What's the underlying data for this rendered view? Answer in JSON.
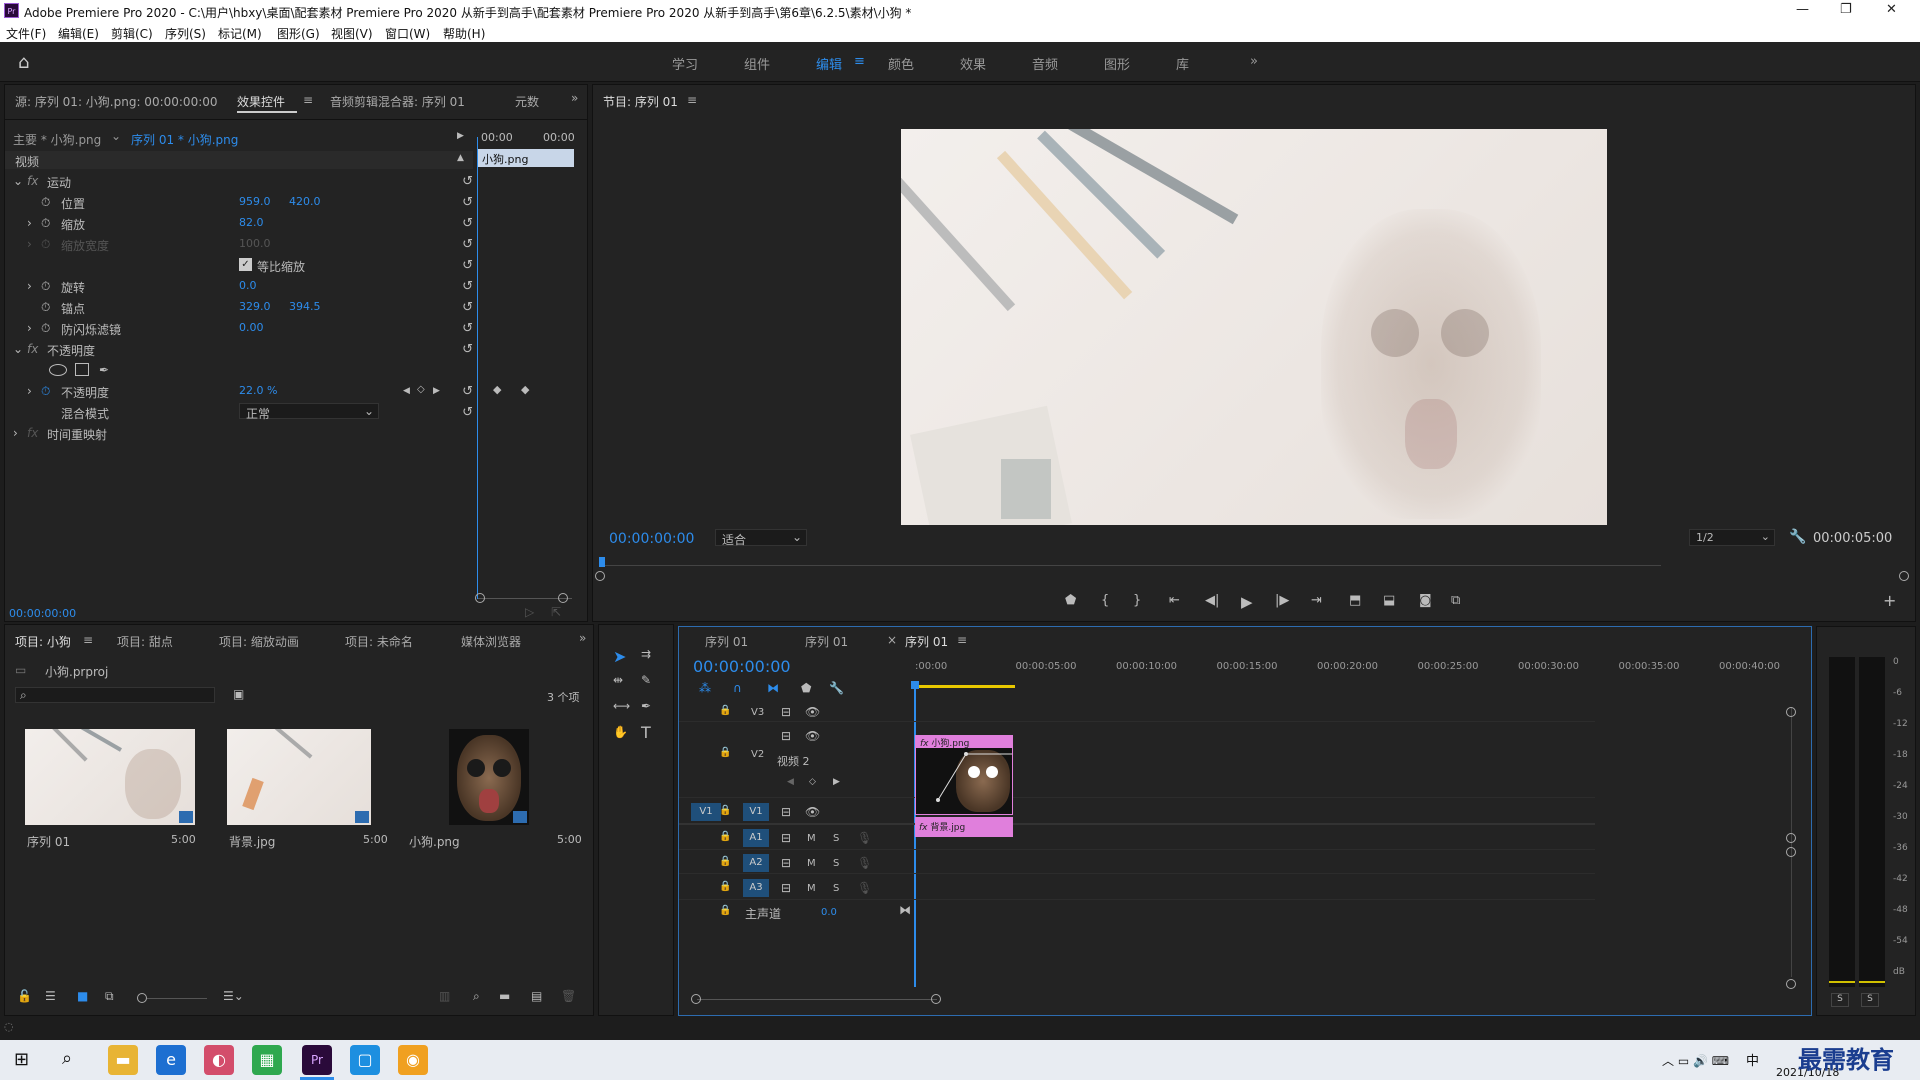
{
  "window": {
    "title": "Adobe Premiere Pro 2020 - C:\\用户\\hbxy\\桌面\\配套素材 Premiere Pro 2020 从新手到高手\\配套素材 Premiere Pro 2020 从新手到高手\\第6章\\6.2.5\\素材\\小狗 *",
    "app_badge": "Pr"
  },
  "menu": [
    "文件(F)",
    "编辑(E)",
    "剪辑(C)",
    "序列(S)",
    "标记(M)",
    "图形(G)",
    "视图(V)",
    "窗口(W)",
    "帮助(H)"
  ],
  "workspaces": [
    "学习",
    "组件",
    "编辑",
    "颜色",
    "效果",
    "音频",
    "图形",
    "库"
  ],
  "active_workspace": "编辑",
  "source_panel": {
    "tabs": [
      "源: 序列 01: 小狗.png: 00:00:00:00",
      "效果控件",
      "音频剪辑混合器: 序列 01",
      "元数"
    ],
    "master": "主要 * 小狗.png",
    "sequence": "序列 01 * 小狗.png",
    "time_start": "00:00",
    "time_end": "00:00",
    "clip_label": "小狗.png",
    "section_video": "视频",
    "motion": "运动",
    "position_label": "位置",
    "position_x": "959.0",
    "position_y": "420.0",
    "scale_label": "缩放",
    "scale": "82.0",
    "scale_width_label": "缩放宽度",
    "scale_width": "100.0",
    "uniform_label": "等比缩放",
    "rotation_label": "旋转",
    "rotation": "0.0",
    "anchor_label": "锚点",
    "anchor_x": "329.0",
    "anchor_y": "394.5",
    "flicker_label": "防闪烁滤镜",
    "flicker": "0.00",
    "opacity_section": "不透明度",
    "opacity_label": "不透明度",
    "opacity": "22.0 %",
    "blend_label": "混合模式",
    "blend": "正常",
    "time_remap": "时间重映射",
    "timecode": "00:00:00:00"
  },
  "program": {
    "title": "节目: 序列 01",
    "timecode": "00:00:00:00",
    "fit": "适合",
    "quality": "1/2",
    "duration": "00:00:05:00"
  },
  "project": {
    "tabs": [
      "项目: 小狗",
      "项目: 甜点",
      "项目: 缩放动画",
      "项目: 未命名",
      "媒体浏览器"
    ],
    "file": "小狗.prproj",
    "count": "3 个项",
    "items": [
      {
        "name": "序列 01",
        "duration": "5:00"
      },
      {
        "name": "背景.jpg",
        "duration": "5:00"
      },
      {
        "name": "小狗.png",
        "duration": "5:00"
      }
    ]
  },
  "timeline": {
    "tabs": [
      "序列 01",
      "序列 01",
      "序列 01"
    ],
    "timecode": "00:00:00:00",
    "ruler": [
      ":00:00",
      "00:00:05:00",
      "00:00:10:00",
      "00:00:15:00",
      "00:00:20:00",
      "00:00:25:00",
      "00:00:30:00",
      "00:00:35:00",
      "00:00:40:00"
    ],
    "tracks": {
      "v3": "V3",
      "v2": "V2",
      "v2_name": "视频 2",
      "v1": "V1",
      "a1": "A1",
      "a2": "A2",
      "a3": "A3",
      "master": "主声道",
      "master_val": "0.0"
    },
    "clip_v2": "小狗.png",
    "clip_v1": "背景.jpg",
    "m": "M",
    "s": "S"
  },
  "meter": {
    "labels": [
      "0",
      "-6",
      "-12",
      "-18",
      "-24",
      "-30",
      "-36",
      "-42",
      "-48",
      "-54",
      "dB"
    ],
    "s": "S"
  },
  "taskbar": {
    "date": "2021/10/18",
    "ime": "中",
    "watermark": "最需教育"
  }
}
